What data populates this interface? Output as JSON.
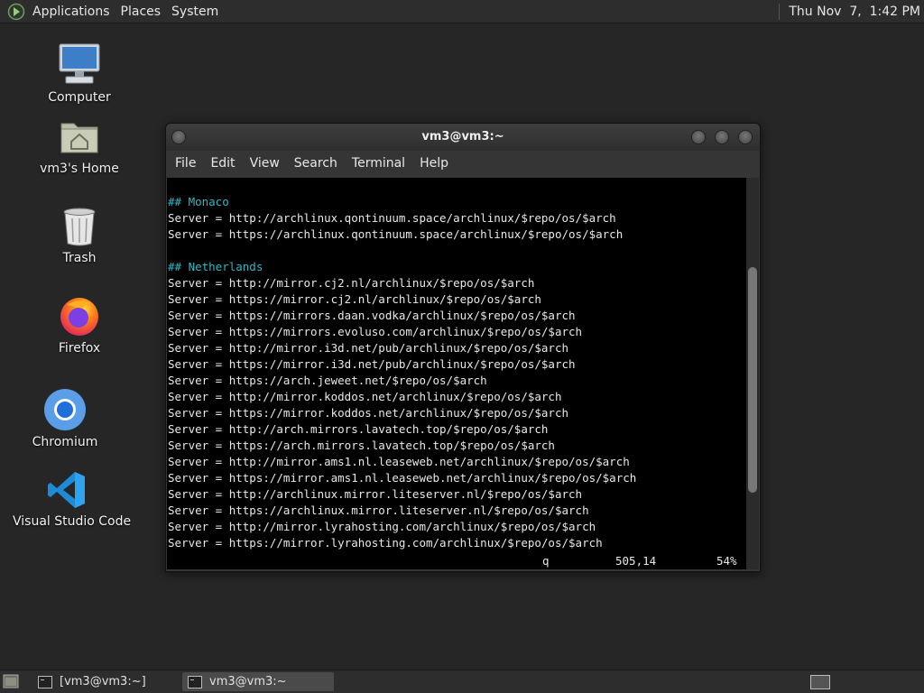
{
  "top_panel": {
    "menus": [
      "Applications",
      "Places",
      "System"
    ],
    "clock": "Thu Nov  7,  1:42 PM"
  },
  "desktop": {
    "icons": [
      {
        "label": "Computer",
        "icon": "computer-icon"
      },
      {
        "label": "vm3's Home",
        "icon": "home-folder-icon"
      },
      {
        "label": "Trash",
        "icon": "trash-icon"
      },
      {
        "label": "Firefox",
        "icon": "firefox-icon"
      },
      {
        "label": "Chromium",
        "icon": "chromium-icon"
      },
      {
        "label": "Visual Studio Code",
        "icon": "vscode-icon"
      }
    ]
  },
  "window": {
    "title": "vm3@vm3:~",
    "menu": [
      "File",
      "Edit",
      "View",
      "Search",
      "Terminal",
      "Help"
    ],
    "lines": [
      "",
      "## Monaco",
      "Server = http://archlinux.qontinuum.space/archlinux/$repo/os/$arch",
      "Server = https://archlinux.qontinuum.space/archlinux/$repo/os/$arch",
      "",
      "## Netherlands",
      "Server = http://mirror.cj2.nl/archlinux/$repo/os/$arch",
      "Server = https://mirror.cj2.nl/archlinux/$repo/os/$arch",
      "Server = https://mirrors.daan.vodka/archlinux/$repo/os/$arch",
      "Server = https://mirrors.evoluso.com/archlinux/$repo/os/$arch",
      "Server = http://mirror.i3d.net/pub/archlinux/$repo/os/$arch",
      "Server = https://mirror.i3d.net/pub/archlinux/$repo/os/$arch",
      "Server = https://arch.jeweet.net/$repo/os/$arch",
      "Server = http://mirror.koddos.net/archlinux/$repo/os/$arch",
      "Server = https://mirror.koddos.net/archlinux/$repo/os/$arch",
      "Server = http://arch.mirrors.lavatech.top/$repo/os/$arch",
      "Server = https://arch.mirrors.lavatech.top/$repo/os/$arch",
      "Server = http://mirror.ams1.nl.leaseweb.net/archlinux/$repo/os/$arch",
      "Server = https://mirror.ams1.nl.leaseweb.net/archlinux/$repo/os/$arch",
      "Server = http://archlinux.mirror.liteserver.nl/$repo/os/$arch",
      "Server = https://archlinux.mirror.liteserver.nl/$repo/os/$arch",
      "Server = http://mirror.lyrahosting.com/archlinux/$repo/os/$arch",
      "Server = https://mirror.lyrahosting.com/archlinux/$repo/os/$arch"
    ],
    "status": {
      "mode": "q",
      "position": "505,14",
      "percent": "54%"
    },
    "scroll_fraction": 0.54
  },
  "taskbar": {
    "items": [
      {
        "label": "[vm3@vm3:~]",
        "active": false
      },
      {
        "label": "vm3@vm3:~",
        "active": true
      }
    ]
  }
}
